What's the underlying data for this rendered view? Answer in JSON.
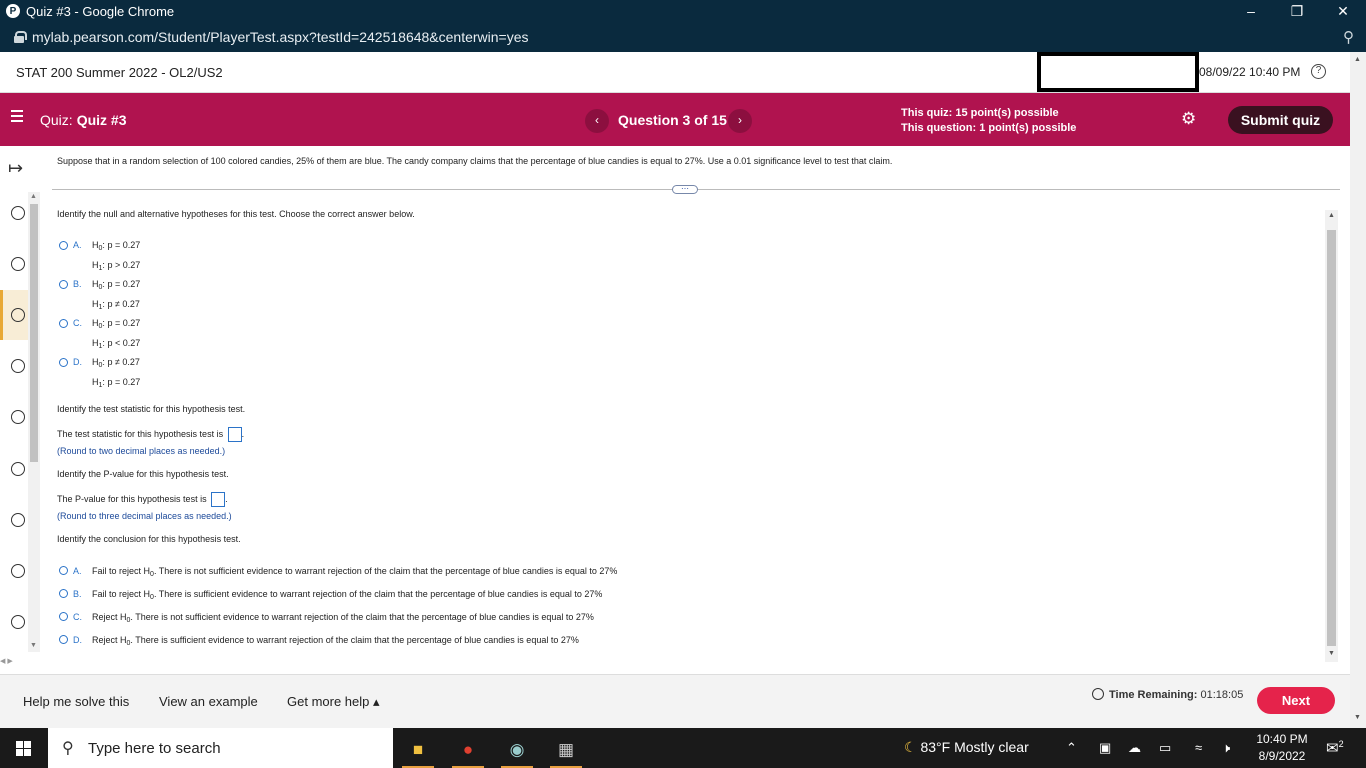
{
  "browser": {
    "title": "Quiz #3 - Google Chrome",
    "favicon_letter": "P",
    "url": "mylab.pearson.com/Student/PlayerTest.aspx?testId=242518648&centerwin=yes",
    "controls": {
      "minimize": "–",
      "restore": "❐",
      "close": "✕"
    }
  },
  "course": {
    "name": "STAT 200 Summer 2022 - OL2/US2",
    "datetime": "08/09/22 10:40 PM",
    "help_icon": "?"
  },
  "quizbar": {
    "quiz_label": "Quiz:",
    "quiz_name": "Quiz #3",
    "prev": "‹",
    "question_counter": "Question 3 of 15",
    "next": "›",
    "quiz_points": "This quiz: 15 point(s) possible",
    "question_points": "This question: 1 point(s) possible",
    "settings_icon": "⚙",
    "submit": "Submit quiz",
    "accent": "#b0134f"
  },
  "question": {
    "stem": "Suppose that in a random selection of 100 colored candies, 25% of them are blue. The candy company claims that the percentage of blue candies is equal to 27%. Use a 0.01 significance level to test that claim.",
    "part1_prompt": "Identify the null and alternative hypotheses for this test. Choose the correct answer below.",
    "hypotheses": [
      {
        "letter": "A.",
        "h0": "p = 0.27",
        "h1": "p > 0.27"
      },
      {
        "letter": "B.",
        "h0": "p = 0.27",
        "h1": "p ≠ 0.27"
      },
      {
        "letter": "C.",
        "h0": "p = 0.27",
        "h1": "p < 0.27"
      },
      {
        "letter": "D.",
        "h0": "p ≠ 0.27",
        "h1": "p = 0.27"
      }
    ],
    "h_letter": "H",
    "h0_sub": "0",
    "h1_sub": "1",
    "colon": ":",
    "part2_prompt": "Identify the test statistic for this hypothesis test.",
    "test_stat_label": "The test statistic for this hypothesis test is",
    "test_stat_hint": "(Round to two decimal places as needed.)",
    "part3_prompt": "Identify the P-value for this hypothesis test.",
    "pvalue_label": "The P-value for this hypothesis test is",
    "pvalue_hint": "(Round to three decimal places as needed.)",
    "period": ".",
    "part4_prompt": "Identify the conclusion for this hypothesis test.",
    "conclusions": [
      {
        "letter": "A.",
        "pre": "Fail to reject H",
        "post": ". There is not sufficient evidence to warrant rejection of the claim that the percentage of blue candies is equal to 27%"
      },
      {
        "letter": "B.",
        "pre": "Fail to reject H",
        "post": ". There is sufficient evidence to warrant rejection of the claim that the percentage of blue candies is equal to 27%"
      },
      {
        "letter": "C.",
        "pre": "Reject H",
        "post": ". There is not sufficient evidence to warrant rejection of the claim that the percentage of blue candies is equal to 27%"
      },
      {
        "letter": "D.",
        "pre": "Reject H",
        "post": ". There is sufficient evidence to warrant rejection of the claim that the percentage of blue candies is equal to 27%"
      }
    ],
    "more_dots": "⋯"
  },
  "footer": {
    "help_solve": "Help me solve this",
    "view_example": "View an example",
    "more_help": "Get more help ▴",
    "time_label": "Time Remaining:",
    "time_value": "01:18:05",
    "next": "Next"
  },
  "taskbar": {
    "search_placeholder": "Type here to search",
    "weather": "83°F  Mostly clear",
    "time": "10:40 PM",
    "date": "8/9/2022",
    "notification_count": "2"
  }
}
